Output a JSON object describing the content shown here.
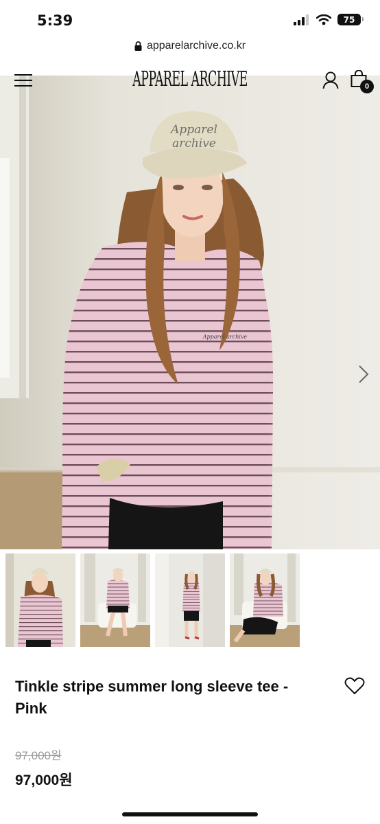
{
  "status_bar": {
    "time": "5:39",
    "battery": "75"
  },
  "browser": {
    "url": "apparelarchive.co.kr"
  },
  "header": {
    "logo": "APPAREL ARCHIVE",
    "cart_count": "0"
  },
  "hero": {
    "cap_text_line1": "Apparel",
    "cap_text_line2": "archive",
    "shirt_text": "Apparel archive"
  },
  "product": {
    "title": "Tinkle stripe summer long sleeve tee - Pink",
    "original_price": "97,000원",
    "sale_price": "97,000원"
  },
  "icons": [
    "menu-icon",
    "user-icon",
    "shopping-bag-icon",
    "chevron-right-icon",
    "heart-icon",
    "lock-icon",
    "signal-icon",
    "wifi-icon",
    "battery-icon"
  ],
  "colors": {
    "shirt_pink": "#e9c6d2",
    "stripe": "#6e4e58",
    "hair": "#8a5a33",
    "cap": "#e2dcc4",
    "wall": "#e6e4dc"
  }
}
